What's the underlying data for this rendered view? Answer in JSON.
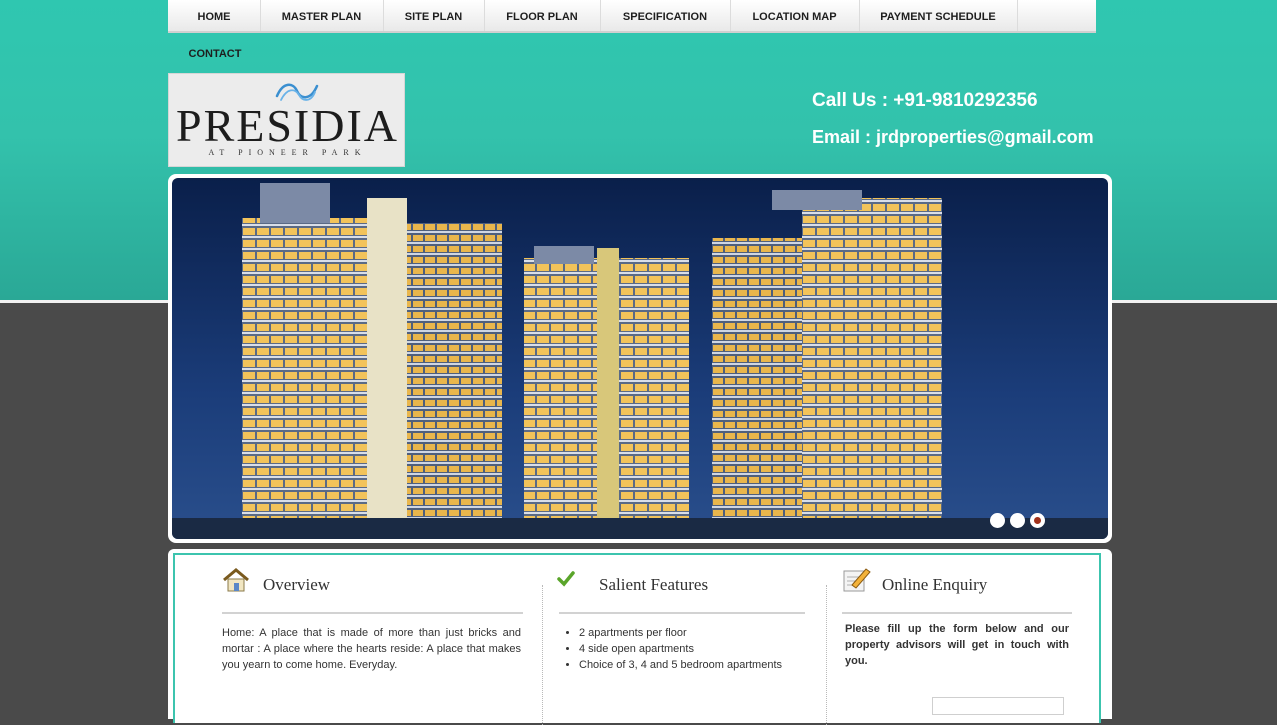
{
  "nav": {
    "items": [
      "HOME",
      "MASTER PLAN",
      "SITE PLAN",
      "FLOOR PLAN",
      "SPECIFICATION",
      "LOCATION MAP",
      "PAYMENT SCHEDULE"
    ],
    "contact": "CONTACT"
  },
  "logo": {
    "brand": "PRESIDIA",
    "subtitle": "AT PIONEER PARK"
  },
  "contact": {
    "call": "Call Us : +91-9810292356",
    "email": "Email : jrdproperties@gmail.com"
  },
  "slider": {
    "dots": 3,
    "active_index": 2
  },
  "overview": {
    "icon": "house-icon",
    "title": "Overview",
    "text": "Home: A place that is made of more than just bricks and mortar : A place where the hearts reside: A place that makes you yearn to come home. Everyday."
  },
  "features": {
    "icon": "checkmark-icon",
    "title": "Salient Features",
    "items": [
      "2 apartments per floor",
      "4 side open apartments",
      "Choice of 3, 4 and 5 bedroom apartments"
    ]
  },
  "enquiry": {
    "icon": "pencil-document-icon",
    "title": "Online Enquiry",
    "text": "Please fill up the form below and our property advisors will get in touch with you."
  },
  "colors": {
    "teal": "#2fc7b0",
    "panel_border": "#3cc4ae",
    "background": "#4a4a4a",
    "slider_active": "#a0301a"
  }
}
